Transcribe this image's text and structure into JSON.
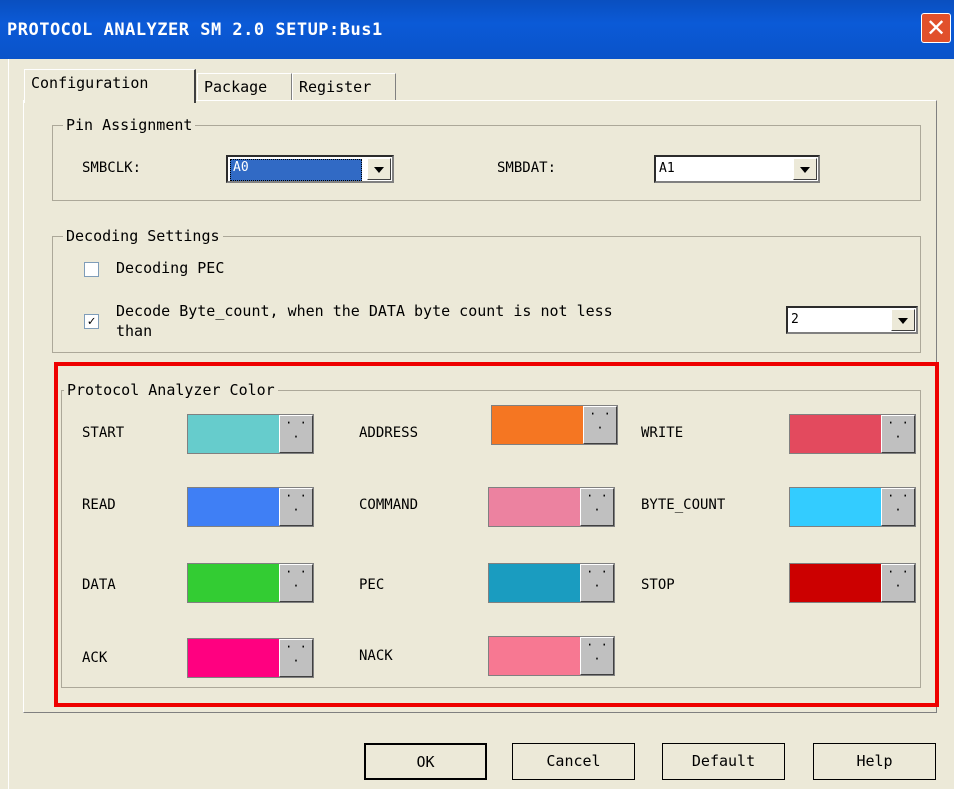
{
  "window": {
    "title": "PROTOCOL ANALYZER SM 2.0 SETUP:Bus1",
    "close_label": "✕"
  },
  "tabs": [
    {
      "label": "Configuration"
    },
    {
      "label": "Package"
    },
    {
      "label": "Register"
    }
  ],
  "pin_assignment": {
    "group_label": "Pin Assignment",
    "smbclk_label": "SMBCLK:",
    "smbclk_value": "A0",
    "smbdat_label": "SMBDAT:",
    "smbdat_value": "A1"
  },
  "decoding": {
    "group_label": "Decoding Settings",
    "pec_label": "Decoding PEC",
    "pec_checked": false,
    "bytecount_label_line1": "Decode Byte_count, when the DATA byte count is not less",
    "bytecount_label_line2": "than",
    "bytecount_checked": true,
    "bytecount_check_mark": "✓",
    "bytecount_value": "2"
  },
  "colors": {
    "group_label": "Protocol Analyzer Color",
    "dots": "· · ·",
    "items": [
      {
        "label": "START",
        "color": "#66cccc"
      },
      {
        "label": "ADDRESS",
        "color": "#f57622"
      },
      {
        "label": "WRITE",
        "color": "#e34a5e"
      },
      {
        "label": "READ",
        "color": "#3f7ff5"
      },
      {
        "label": "COMMAND",
        "color": "#ec82a0"
      },
      {
        "label": "BYTE_COUNT",
        "color": "#33ccff"
      },
      {
        "label": "DATA",
        "color": "#33cc33"
      },
      {
        "label": "PEC",
        "color": "#1a9cc0"
      },
      {
        "label": "STOP",
        "color": "#cc0000"
      },
      {
        "label": "ACK",
        "color": "#ff0080"
      },
      {
        "label": "NACK",
        "color": "#f77892"
      }
    ]
  },
  "buttons": {
    "ok": "OK",
    "cancel": "Cancel",
    "default": "Default",
    "help": "Help"
  }
}
